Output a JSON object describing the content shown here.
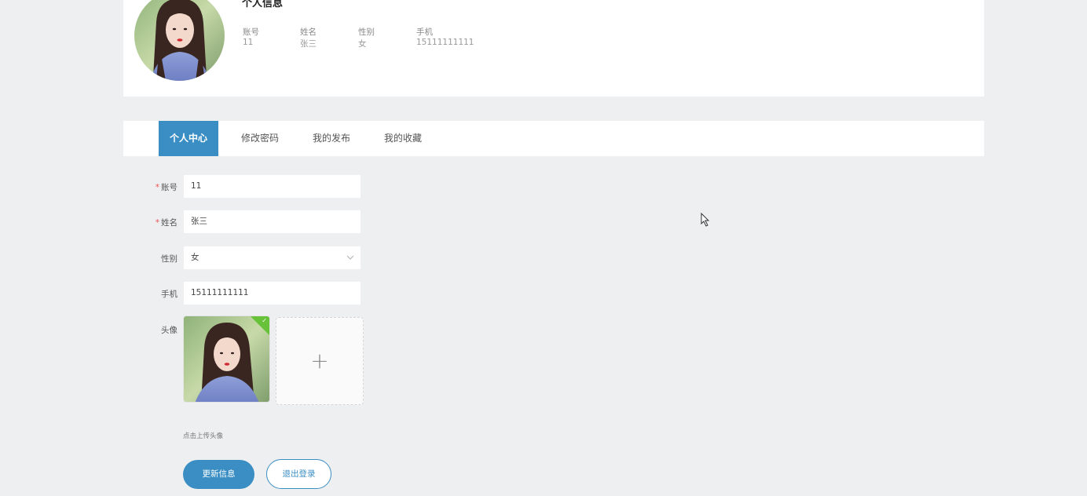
{
  "profile": {
    "title": "个人信息",
    "fields": [
      {
        "label": "账号",
        "value": "11"
      },
      {
        "label": "姓名",
        "value": "张三"
      },
      {
        "label": "性别",
        "value": "女"
      },
      {
        "label": "手机",
        "value": "15111111111"
      }
    ]
  },
  "tabs": [
    {
      "label": "个人中心",
      "active": true
    },
    {
      "label": "修改密码",
      "active": false
    },
    {
      "label": "我的发布",
      "active": false
    },
    {
      "label": "我的收藏",
      "active": false
    }
  ],
  "form": {
    "account": {
      "label": "账号",
      "required_mark": "*",
      "value": "11"
    },
    "name": {
      "label": "姓名",
      "required_mark": "*",
      "value": "张三"
    },
    "gender": {
      "label": "性别",
      "value": "女"
    },
    "phone": {
      "label": "手机",
      "value": "15111111111"
    },
    "avatar": {
      "label": "头像",
      "add_symbol": "+",
      "tip": "点击上传头像",
      "check_symbol": "✓"
    }
  },
  "buttons": {
    "update": "更新信息",
    "logout": "退出登录"
  },
  "colors": {
    "accent": "#3a8ec3",
    "page_bg": "#eeeff1",
    "success": "#67c23a"
  }
}
